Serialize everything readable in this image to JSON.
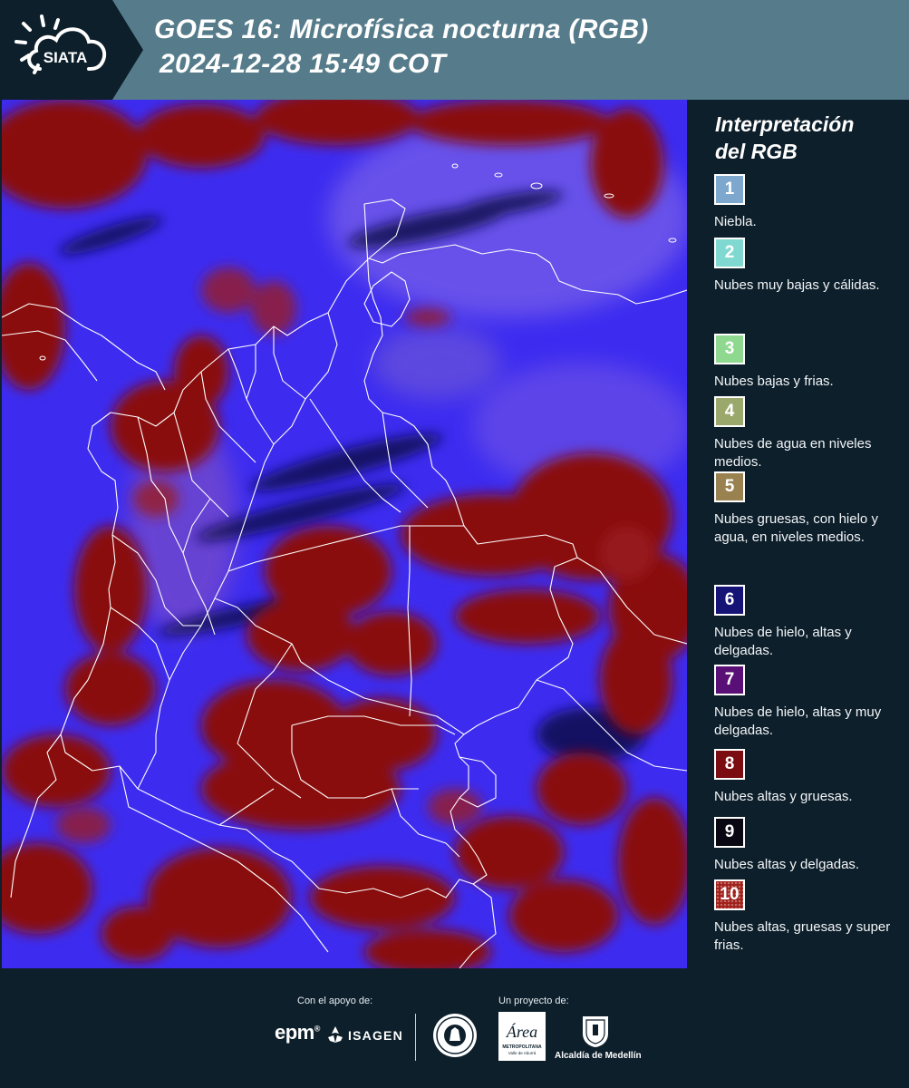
{
  "header": {
    "logo_text": "SIATA",
    "title_line1": "GOES 16: Microfísica nocturna (RGB)",
    "title_line2": "2024-12-28 15:49 COT"
  },
  "legend": {
    "title_line1": "Interpretación",
    "title_line2": "del RGB",
    "items": [
      {
        "number": "1",
        "label": "Niebla.",
        "color": "#7ea7cd"
      },
      {
        "number": "2",
        "label": "Nubes muy bajas y cálidas.",
        "color": "#7fd9d1"
      },
      {
        "number": "3",
        "label": "Nubes bajas y frias.",
        "color": "#8ed98f"
      },
      {
        "number": "4",
        "label": "Nubes de agua en niveles medios.",
        "color": "#9aa86c"
      },
      {
        "number": "5",
        "label": "Nubes gruesas, con hielo y agua, en niveles medios.",
        "color": "#9a8150"
      },
      {
        "number": "6",
        "label": "Nubes de hielo, altas y delgadas.",
        "color": "#151375"
      },
      {
        "number": "7",
        "label": "Nubes de hielo, altas y muy delgadas.",
        "color": "#5a0f76"
      },
      {
        "number": "8",
        "label": "Nubes altas y gruesas.",
        "color": "#7a0c12"
      },
      {
        "number": "9",
        "label": "Nubes altas y delgadas.",
        "color": "#090812"
      },
      {
        "number": "10",
        "label": "Nubes altas, gruesas y super frias.",
        "color": "#a0201a"
      }
    ]
  },
  "map": {
    "background_color": "#3d2cf0",
    "cloud_color": "#8a0d0d",
    "border_color": "#ffffff"
  },
  "footer": {
    "support_label": "Con el apoyo de:",
    "project_label": "Un proyecto de:",
    "epm": "epm",
    "isagen": "ISAGEN",
    "area_metro": "Área",
    "area_metro_sub": "METROPOLITANA",
    "area_metro_sub2": "Valle de Aburrá",
    "alcaldia": "Alcaldía de Medellín"
  }
}
